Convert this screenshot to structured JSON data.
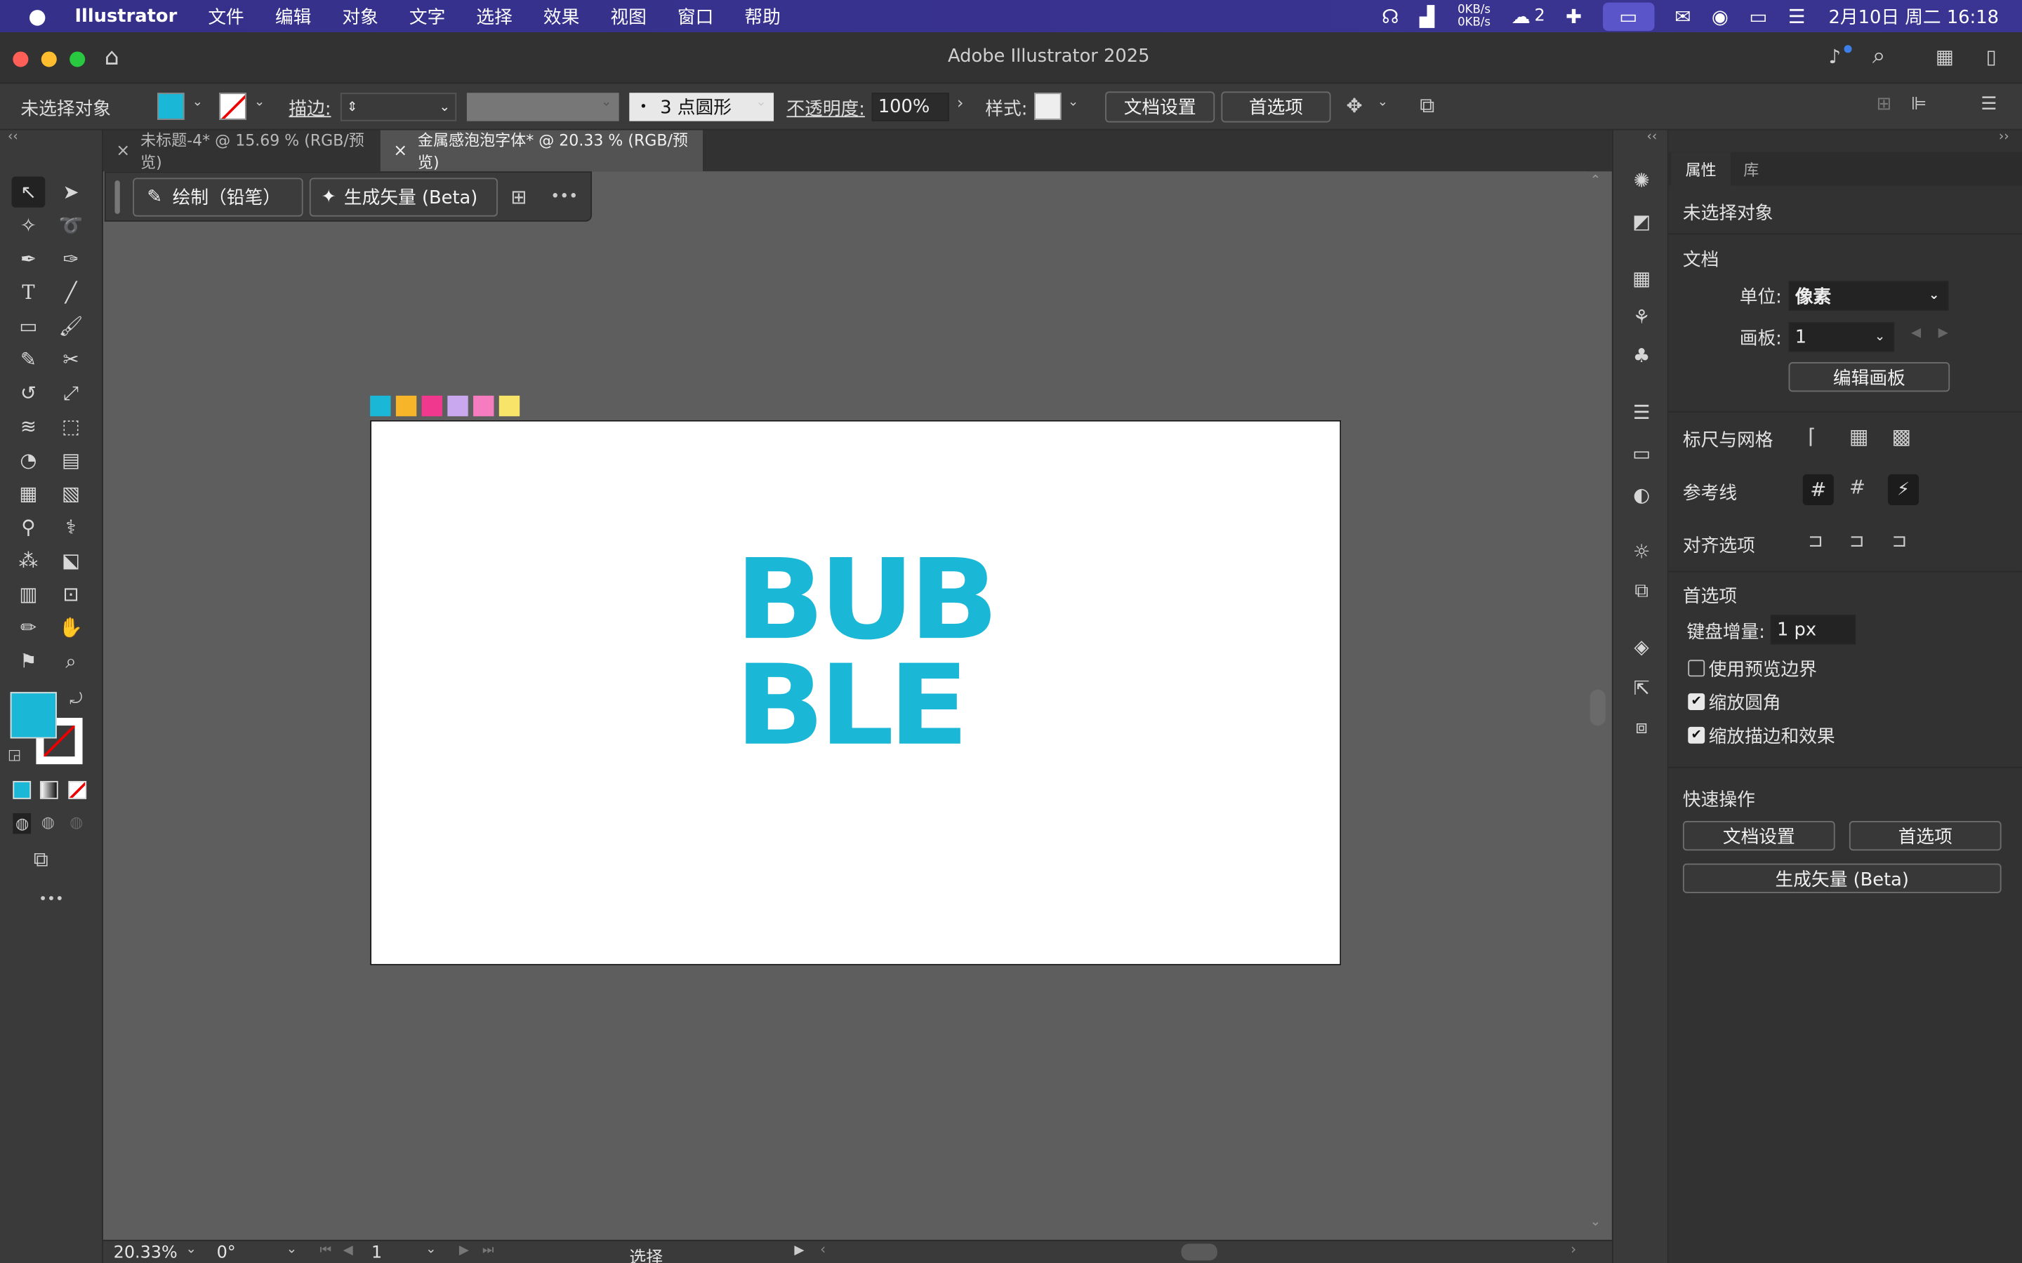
{
  "menubar": {
    "app": "Illustrator",
    "items": [
      "文件",
      "编辑",
      "对象",
      "文字",
      "选择",
      "效果",
      "视图",
      "窗口",
      "帮助"
    ],
    "net_up": "0KB/s",
    "net_down": "0KB/s",
    "badge_count": "2",
    "datetime": "2月10日 周二  16:18"
  },
  "titlebar": {
    "title": "Adobe Illustrator 2025"
  },
  "control": {
    "no_selection": "未选择对象",
    "fill_color": "#1bb7d6",
    "stroke_label": "描边:",
    "brush_label": "3 点圆形",
    "brush_dot": "•",
    "opacity_label": "不透明度:",
    "opacity_value": "100%",
    "style_label": "样式:",
    "doc_setup": "文档设置",
    "prefs": "首选项"
  },
  "tabs": [
    {
      "label": "未标题-4* @ 15.69 % (RGB/预览)"
    },
    {
      "label": "金属感泡泡字体* @ 20.33 % (RGB/预览)"
    }
  ],
  "tab_close": "×",
  "contextbar": {
    "draw": "绘制（铅笔）",
    "generate": "生成矢量 (Beta)",
    "more": "•••"
  },
  "artboard": {
    "swatches": [
      "#1bb7d6",
      "#f7b52a",
      "#f0388f",
      "#c9a8f0",
      "#f47cbf",
      "#f9e46a"
    ],
    "word_line1": "BUB",
    "word_line2": "BLE",
    "word_color": "#1bb7d6"
  },
  "panel": {
    "tab_props": "属性",
    "tab_lib": "库",
    "no_selection": "未选择对象",
    "doc_header": "文档",
    "unit_label": "单位:",
    "unit_value": "像素",
    "artboard_label": "画板:",
    "artboard_value": "1",
    "edit_artboard": "编辑画板",
    "rulers_grid": "标尺与网格",
    "guides": "参考线",
    "align_opts": "对齐选项",
    "prefs_header": "首选项",
    "key_inc_label": "键盘增量:",
    "key_inc_value": "1 px",
    "use_preview_bounds": "使用预览边界",
    "scale_corners": "缩放圆角",
    "scale_strokes": "缩放描边和效果",
    "quick_actions": "快速操作",
    "qa_doc_setup": "文档设置",
    "qa_prefs": "首选项",
    "qa_generate": "生成矢量 (Beta)"
  },
  "status": {
    "zoom": "20.33%",
    "rotate": "0°",
    "artboard": "1",
    "tool": "选择"
  },
  "toolbar": {
    "fill_color": "#1bb7d6",
    "more": "•••"
  }
}
